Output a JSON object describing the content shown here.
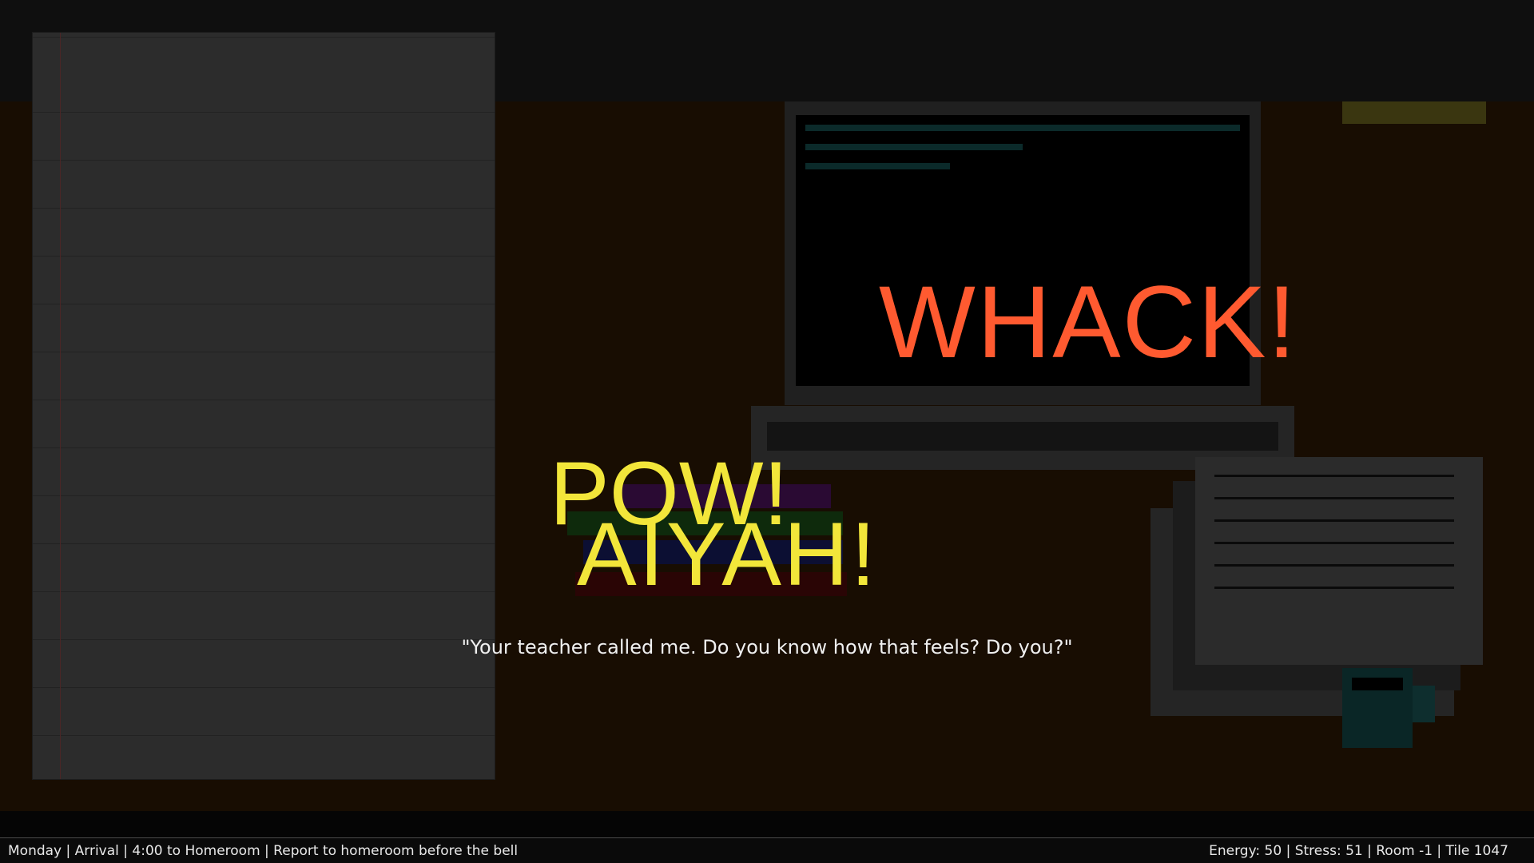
{
  "effects": {
    "whack": "WHACK!",
    "pow": "POW!",
    "aiyah": "AIYAH!"
  },
  "dialogue": "\"Your teacher called me. Do you know how that feels? Do you?\"",
  "status": {
    "left": "Monday | Arrival | 4:00 to Homeroom | Report to homeroom before the bell",
    "right": "Energy: 50 | Stress: 51 | Room -1 | Tile 1047"
  },
  "colors": {
    "whack": "#ff5a30",
    "pow": "#f2e63a",
    "floor": "#180d02"
  }
}
